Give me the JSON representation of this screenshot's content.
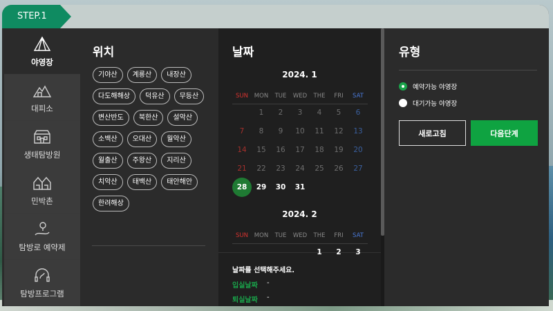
{
  "step": "STEP.1",
  "nav": [
    {
      "label": "야영장",
      "icon": "tent-icon",
      "active": true
    },
    {
      "label": "대피소",
      "icon": "shelter-icon",
      "active": false
    },
    {
      "label": "생태탐방원",
      "icon": "eco-center-icon",
      "active": false
    },
    {
      "label": "민박촌",
      "icon": "village-icon",
      "active": false
    },
    {
      "label": "탐방로 예약제",
      "icon": "trail-icon",
      "active": false
    },
    {
      "label": "탐방프로그램",
      "icon": "program-icon",
      "active": false
    }
  ],
  "location": {
    "title": "위치",
    "chips": [
      "기야산",
      "계룡산",
      "내장산",
      "다도해해상",
      "덕유산",
      "무등산",
      "변산반도",
      "북한산",
      "설악산",
      "소백산",
      "오대산",
      "월악산",
      "월출산",
      "주왕산",
      "지리산",
      "치악산",
      "태백산",
      "태안해안",
      "한려해상"
    ]
  },
  "date": {
    "title": "날짜",
    "months": [
      {
        "label": "2024. 1",
        "weeks": [
          [
            "",
            "1",
            "2",
            "3",
            "4",
            "5",
            "6"
          ],
          [
            "7",
            "8",
            "9",
            "10",
            "11",
            "12",
            "13"
          ],
          [
            "14",
            "15",
            "16",
            "17",
            "18",
            "19",
            "20"
          ],
          [
            "21",
            "22",
            "23",
            "24",
            "25",
            "26",
            "27"
          ],
          [
            "28",
            "29",
            "30",
            "31",
            "",
            "",
            ""
          ]
        ]
      },
      {
        "label": "2024. 2",
        "weeks": [
          [
            "",
            "",
            "",
            "",
            "1",
            "2",
            "3"
          ]
        ]
      }
    ],
    "weekdays": [
      "SUN",
      "MON",
      "TUE",
      "WED",
      "THE",
      "FRI",
      "SAT"
    ],
    "prompt": "날짜를 선택해주세요.",
    "checkin_label": "입실날짜",
    "checkin_value": "-",
    "checkout_label": "퇴실날짜",
    "checkout_value": "-"
  },
  "type": {
    "title": "유형",
    "options": [
      {
        "label": "예약가능 야영장",
        "selected": true
      },
      {
        "label": "대기가능 야영장",
        "selected": false
      }
    ],
    "reset_label": "새로고침",
    "next_label": "다음단계"
  }
}
